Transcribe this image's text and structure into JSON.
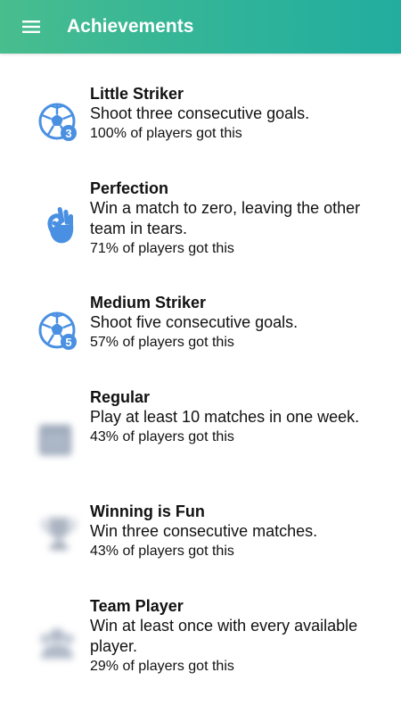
{
  "header": {
    "title": "Achievements",
    "menu_icon": "menu-icon"
  },
  "colors": {
    "header_gradient_start": "#48bd8e",
    "header_gradient_end": "#22ad9f",
    "icon_blue": "#4a90e2",
    "text": "#111111"
  },
  "achievements": [
    {
      "name": "Little Striker",
      "description": "Shoot three consecutive goals.",
      "stat": "100% of players got this",
      "icon": "soccer-ball-3-icon",
      "badge": "3",
      "unlocked": true
    },
    {
      "name": "Perfection",
      "description": "Win a match to zero, leaving the other team in tears.",
      "stat": "71% of players got this",
      "icon": "ok-hand-icon",
      "unlocked": true
    },
    {
      "name": "Medium Striker",
      "description": "Shoot five consecutive goals.",
      "stat": "57% of players got this",
      "icon": "soccer-ball-5-icon",
      "badge": "5",
      "unlocked": true
    },
    {
      "name": "Regular",
      "description": "Play at least 10 matches in one week.",
      "stat": "43% of players got this",
      "icon": "calendar-icon",
      "unlocked": false
    },
    {
      "name": "Winning is Fun",
      "description": "Win three consecutive matches.",
      "stat": "43% of players got this",
      "icon": "trophy-icon",
      "unlocked": false
    },
    {
      "name": "Team Player",
      "description": "Win at least once with every available player.",
      "stat": "29% of players got this",
      "icon": "team-icon",
      "unlocked": false
    }
  ]
}
